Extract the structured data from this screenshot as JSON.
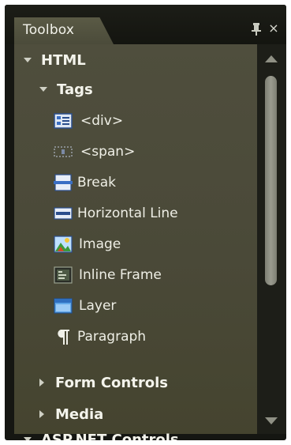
{
  "toolbox": {
    "title": "Toolbox",
    "pin_icon": "pin-icon",
    "close_icon": "close-icon",
    "close_glyph": "×",
    "pin_glyph": "📌"
  },
  "tree": {
    "html": {
      "label": "HTML",
      "expanded": true
    },
    "tags": {
      "label": "Tags",
      "expanded": true,
      "items": [
        {
          "label": "<div>",
          "icon": "div-icon"
        },
        {
          "label": "<span>",
          "icon": "span-icon"
        },
        {
          "label": "Break",
          "icon": "break-icon"
        },
        {
          "label": "Horizontal Line",
          "icon": "horizontal-line-icon"
        },
        {
          "label": "Image",
          "icon": "image-icon"
        },
        {
          "label": "Inline Frame",
          "icon": "inline-frame-icon"
        },
        {
          "label": "Layer",
          "icon": "layer-icon"
        },
        {
          "label": "Paragraph",
          "icon": "paragraph-icon"
        }
      ]
    },
    "form_controls": {
      "label": "Form Controls",
      "expanded": false
    },
    "media": {
      "label": "Media",
      "expanded": false
    },
    "asp_net": {
      "label": "ASP.NET Controls",
      "expanded": true
    }
  }
}
